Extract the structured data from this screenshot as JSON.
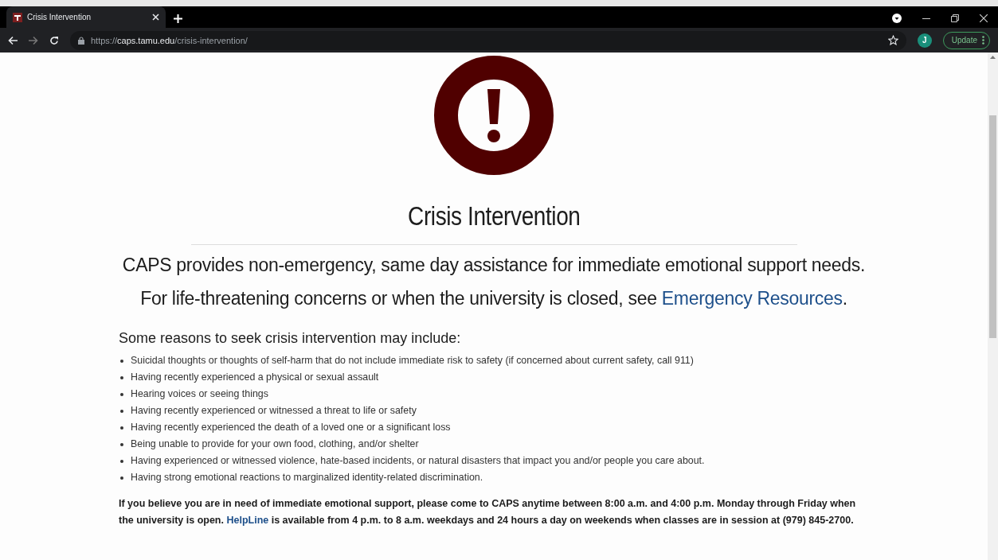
{
  "browser": {
    "tab": {
      "title": "Crisis Intervention",
      "selected": true
    },
    "url": {
      "scheme": "https://",
      "host": "caps.tamu.edu",
      "path": "/crisis-intervention/"
    },
    "avatar": "J",
    "update_button": "Update"
  },
  "page": {
    "title": "Crisis Intervention",
    "intro": [
      {
        "text": "CAPS provides non-emergency, same day assistance for immediate emotional support needs."
      },
      {
        "text": "For life-threatening concerns or when the university is closed, see ",
        "link": "Emergency Resources",
        "after": "."
      }
    ],
    "reasons_heading": "Some reasons to seek crisis intervention may include:",
    "reasons": [
      "Suicidal thoughts or thoughts of self-harm that do not include immediate risk to safety (if concerned about current safety, call 911)",
      "Having recently experienced a physical or sexual assault",
      "Hearing voices or seeing things",
      "Having recently experienced or witnessed a threat to life or safety",
      "Having recently experienced the death of a loved one or a significant loss",
      "Being unable to provide for your own food, clothing, and/or shelter",
      "Having experienced or witnessed violence, hate-based incidents, or natural disasters that impact you and/or people you care about.",
      "Having strong emotional reactions to marginalized identity-related discrimination."
    ],
    "notice": {
      "before": "If you believe you are in need of immediate emotional support, please come to CAPS anytime between 8:00 a.m. and 4:00 p.m. Monday through Friday when the university is open. ",
      "link": "HelpLine",
      "after": " is available from 4 p.m. to 8 a.m. weekdays and 24 hours a day on weekends when classes are in session at (979) 845-2700."
    }
  }
}
